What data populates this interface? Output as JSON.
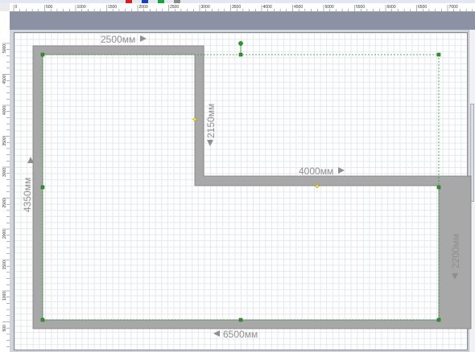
{
  "rulers": {
    "horizontal_ticks": [
      "0",
      "500",
      "1000",
      "1500",
      "2000",
      "2500",
      "3000",
      "3500",
      "4000",
      "4500",
      "5000",
      "5500",
      "6000",
      "6500",
      "7000"
    ],
    "vertical_ticks": [
      "5000",
      "4500",
      "4000",
      "3500",
      "3000",
      "2500",
      "2000",
      "1500",
      "1000",
      "500"
    ]
  },
  "toolbar_colors": [
    "#d42020",
    "#1a3fbf",
    "#1aa040",
    "#8a8a8a"
  ],
  "dimensions": {
    "top_segment": "2500мм",
    "inner_vertical": "2150мм",
    "inner_horizontal": "4000мм",
    "left_side": "4350мм",
    "right_side": "2200мм",
    "bottom_side": "6500мм"
  },
  "colors": {
    "wall_fill": "#a8a8a8",
    "wall_stroke": "#7c7c7c",
    "selection": "#2a9a2a",
    "dimension_text": "#8f8f8f"
  }
}
